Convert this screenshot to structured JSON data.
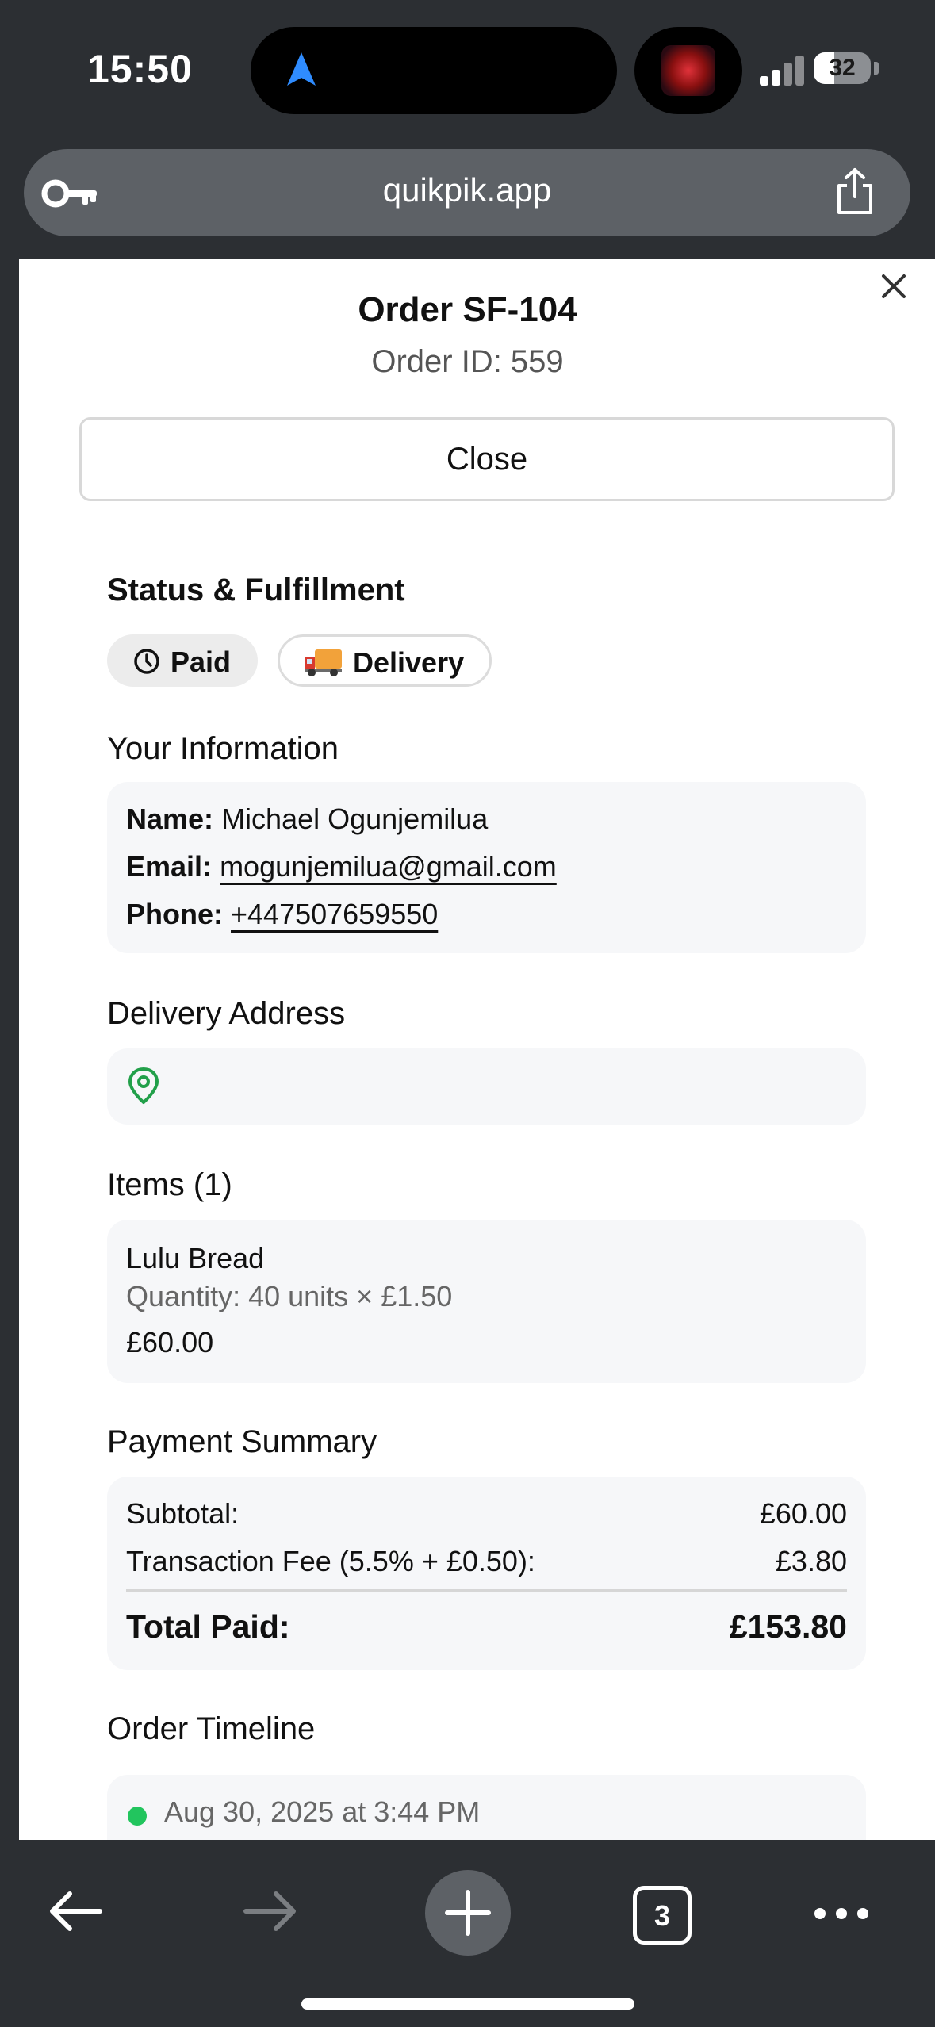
{
  "status_bar": {
    "time": "15:50",
    "battery": "32"
  },
  "browser": {
    "url": "quikpik.app",
    "tab_count": "3"
  },
  "order": {
    "title": "Order SF-104",
    "order_id": "Order ID: 559",
    "close_label": "Close"
  },
  "status": {
    "heading": "Status & Fulfillment",
    "payment_badge": "Paid",
    "fulfillment_badge": "Delivery"
  },
  "customer": {
    "heading": "Your Information",
    "name_label": "Name:",
    "name": "Michael Ogunjemilua",
    "email_label": "Email:",
    "email": "mogunjemilua@gmail.com",
    "phone_label": "Phone:",
    "phone": "+447507659550"
  },
  "delivery": {
    "heading": "Delivery Address"
  },
  "items": {
    "heading": "Items (1)",
    "list": [
      {
        "name": "Lulu Bread",
        "quantity": "Quantity: 40 units × £1.50",
        "price": "£60.00"
      }
    ]
  },
  "payment": {
    "heading": "Payment Summary",
    "subtotal_label": "Subtotal:",
    "subtotal": "£60.00",
    "fee_label": "Transaction Fee (5.5% + £0.50):",
    "fee": "£3.80",
    "total_label": "Total Paid:",
    "total": "£153.80"
  },
  "timeline": {
    "heading": "Order Timeline",
    "events": [
      {
        "date": "Aug 30, 2025 at 3:44 PM",
        "status_color": "#22c55e"
      }
    ]
  },
  "colors": {
    "chrome": "#2c2f33",
    "success": "#22c55e",
    "card": "#f6f7f9",
    "accent_blue": "#2f8cff"
  }
}
